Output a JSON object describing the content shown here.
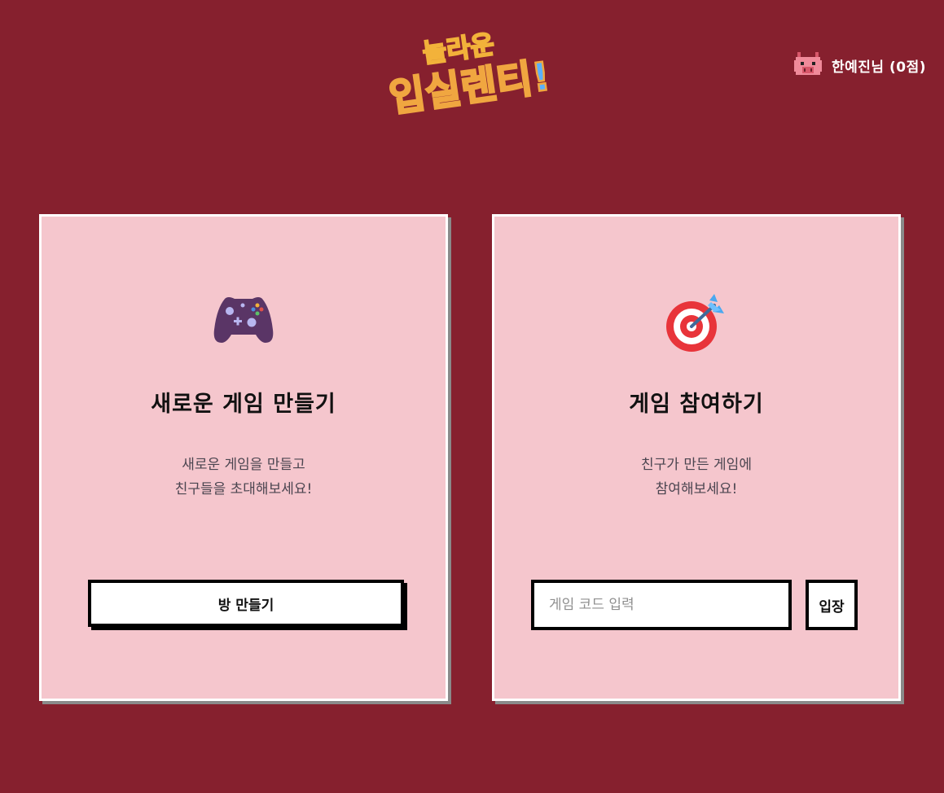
{
  "header": {
    "logo_line1": "놀라운",
    "logo_line2": "입실렌티!",
    "user_name": "한예진님 (0점)"
  },
  "create_card": {
    "icon": "game-controller-icon",
    "title": "새로운 게임 만들기",
    "desc_line1": "새로운 게임을 만들고",
    "desc_line2": "친구들을 초대해보세요!",
    "button_label": "방 만들기"
  },
  "join_card": {
    "icon": "bullseye-dart-icon",
    "title": "게임 참여하기",
    "desc_line1": "친구가 만든 게임에",
    "desc_line2": "참여해보세요!",
    "input_placeholder": "게임 코드 입력",
    "button_label": "입장"
  },
  "colors": {
    "background": "#86202e",
    "card": "#f5c6cd",
    "card_border": "#ffffff",
    "button_border": "#000000"
  }
}
